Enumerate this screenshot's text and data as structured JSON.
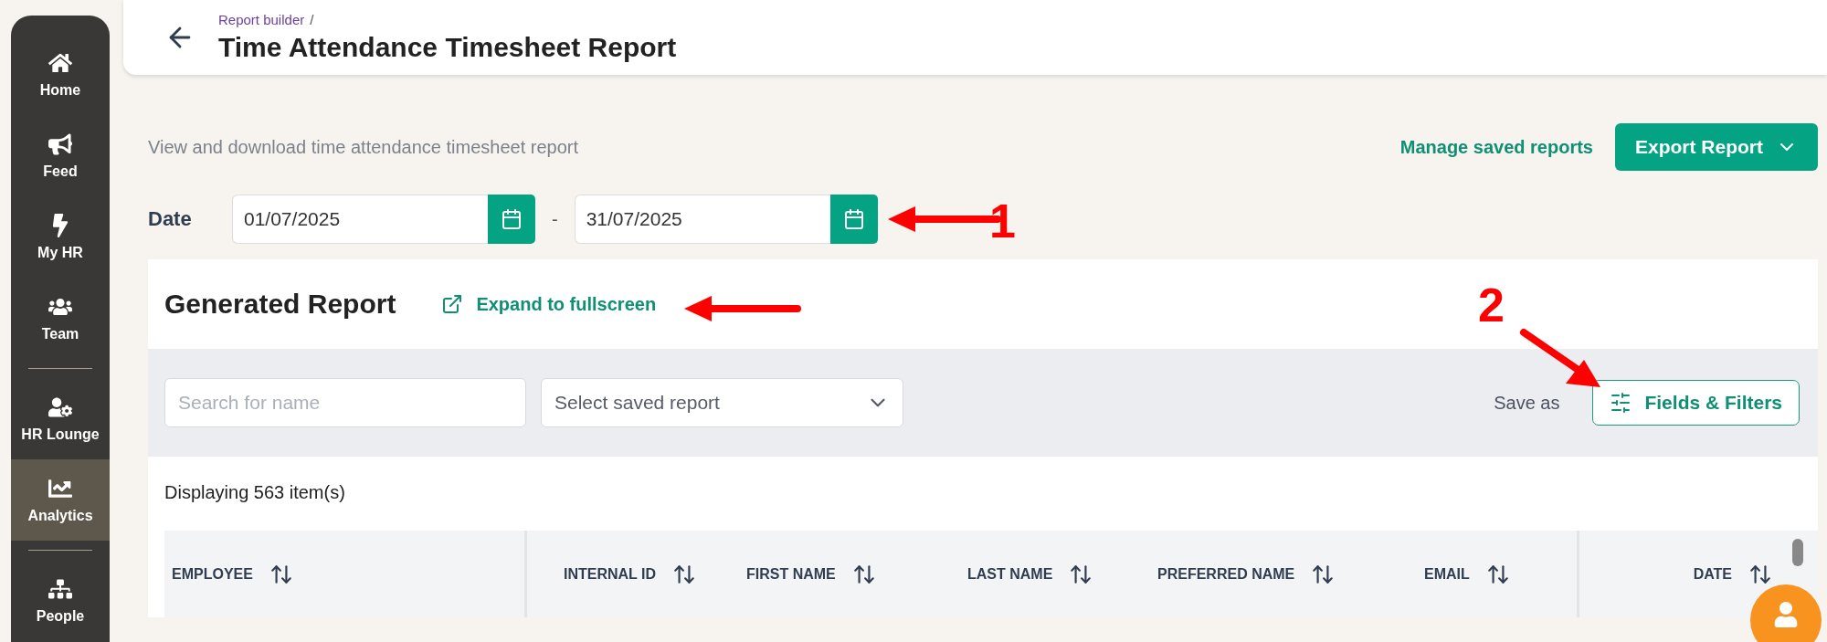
{
  "sidebar": {
    "items": [
      {
        "label": "Home",
        "selected": false
      },
      {
        "label": "Feed",
        "selected": false
      },
      {
        "label": "My HR",
        "selected": false
      },
      {
        "label": "Team",
        "selected": false
      },
      {
        "label": "HR Lounge",
        "selected": false
      },
      {
        "label": "Analytics",
        "selected": true
      },
      {
        "label": "People",
        "selected": false
      }
    ]
  },
  "header": {
    "breadcrumb": "Report builder",
    "separator": "/",
    "title": "Time Attendance Timesheet Report"
  },
  "description": "View and download time attendance timesheet report",
  "actions": {
    "manage_link": "Manage saved reports",
    "export_button": "Export Report"
  },
  "date_range": {
    "label": "Date",
    "from": "01/07/2025",
    "separator": "-",
    "to": "31/07/2025"
  },
  "report": {
    "title": "Generated Report",
    "expand_link": "Expand to fullscreen",
    "search": {
      "placeholder": "Search for name"
    },
    "saved_report_select": {
      "placeholder": "Select saved report"
    },
    "save_as": "Save as",
    "fields_button": "Fields & Filters",
    "count": "Displaying 563 item(s)",
    "columns": [
      "EMPLOYEE",
      "INTERNAL ID",
      "FIRST NAME",
      "LAST NAME",
      "PREFERRED NAME",
      "EMAIL",
      "DATE"
    ]
  },
  "annotations": [
    {
      "number": "1"
    },
    {
      "number": "2"
    }
  ]
}
